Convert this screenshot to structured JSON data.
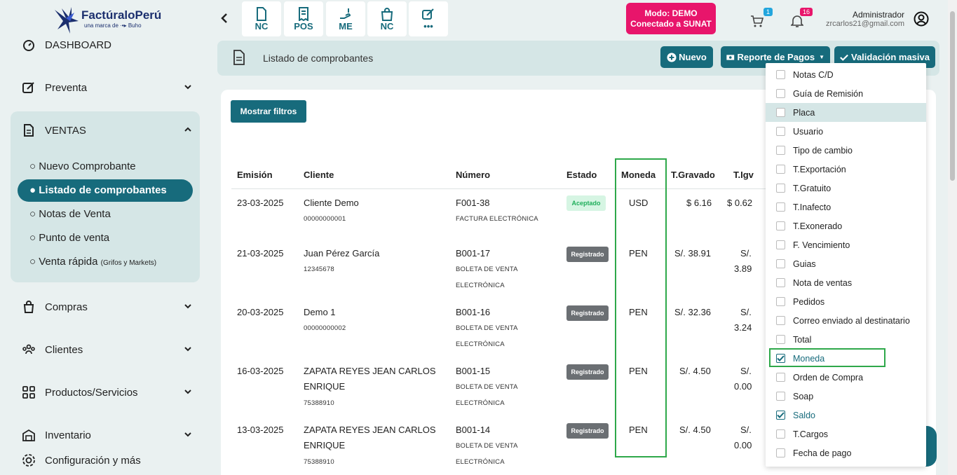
{
  "brand": {
    "name": "FactúraloPerú",
    "sub": "una marca de ·•▸ Buho"
  },
  "sidebar": {
    "dashboard": "DASHBOARD",
    "preventa": "Preventa",
    "ventas": "VENTAS",
    "ventas_items": [
      "Nuevo Comprobante",
      "Listado de comprobantes",
      "Notas de Venta",
      "Punto de venta",
      "Venta rápida"
    ],
    "venta_rapida_note": "(Grifos y Markets)",
    "compras": "Compras",
    "clientes": "Clientes",
    "productos": "Productos/Servicios",
    "inventario": "Inventario",
    "config": "Configuración y más"
  },
  "topbar": {
    "quick_labels": [
      "NC",
      "POS",
      "ME",
      "NC",
      "•••"
    ],
    "modo_line1": "Modo: DEMO",
    "modo_line2": "Conectado a SUNAT",
    "cart_count": "1",
    "bell_count": "16",
    "admin_name": "Administrador",
    "admin_email": "zrcarlos21@gmail.com"
  },
  "header": {
    "title": "Listado de comprobantes",
    "nuevo": "Nuevo",
    "reporte": "Reporte de Pagos",
    "validacion": "Validación masiva"
  },
  "filters": {
    "label": "Mostrar filtros"
  },
  "table": {
    "headers": [
      "Emisión",
      "Cliente",
      "Número",
      "Estado",
      "Moneda",
      "T.Gravado",
      "T.Igv"
    ],
    "rows": [
      {
        "emision": "23-03-2025",
        "cliente": [
          "Cliente Demo"
        ],
        "doc": "00000000001",
        "numero": "F001-38",
        "tipo": [
          "FACTURA ELECTRÓNICA"
        ],
        "estado": "Aceptado",
        "moneda": "USD",
        "gravado": "$ 6.16",
        "igv": [
          "$ 0.62"
        ]
      },
      {
        "emision": "21-03-2025",
        "cliente": [
          "Juan Pérez García"
        ],
        "doc": "12345678",
        "numero": "B001-17",
        "tipo": [
          "BOLETA DE VENTA",
          "ELECTRÓNICA"
        ],
        "estado": "Registrado",
        "moneda": "PEN",
        "gravado": "S/. 38.91",
        "igv": [
          "S/.",
          "3.89"
        ]
      },
      {
        "emision": "20-03-2025",
        "cliente": [
          "Demo 1"
        ],
        "doc": "00000000002",
        "numero": "B001-16",
        "tipo": [
          "BOLETA DE VENTA",
          "ELECTRÓNICA"
        ],
        "estado": "Registrado",
        "moneda": "PEN",
        "gravado": "S/. 32.36",
        "igv": [
          "S/.",
          "3.24"
        ]
      },
      {
        "emision": "16-03-2025",
        "cliente": [
          "ZAPATA REYES JEAN CARLOS",
          "ENRIQUE"
        ],
        "doc": "75388910",
        "numero": "B001-15",
        "tipo": [
          "BOLETA DE VENTA",
          "ELECTRÓNICA"
        ],
        "estado": "Registrado",
        "moneda": "PEN",
        "gravado": "S/. 4.50",
        "igv": [
          "S/.",
          "0.00"
        ]
      },
      {
        "emision": "13-03-2025",
        "cliente": [
          "ZAPATA REYES JEAN CARLOS",
          "ENRIQUE"
        ],
        "doc": "75388910",
        "numero": "B001-14",
        "tipo": [
          "BOLETA DE VENTA",
          "ELECTRÓNICA"
        ],
        "estado": "Registrado",
        "moneda": "PEN",
        "gravado": "S/. 4.50",
        "igv": [
          "S/.",
          "0.00"
        ]
      }
    ]
  },
  "columns_menu": [
    {
      "label": "Notas C/D",
      "checked": false
    },
    {
      "label": "Guía de Remisión",
      "checked": false
    },
    {
      "label": "Placa",
      "checked": false,
      "hover": true
    },
    {
      "label": "Usuario",
      "checked": false
    },
    {
      "label": "Tipo de cambio",
      "checked": false
    },
    {
      "label": "T.Exportación",
      "checked": false
    },
    {
      "label": "T.Gratuito",
      "checked": false
    },
    {
      "label": "T.Inafecto",
      "checked": false
    },
    {
      "label": "T.Exonerado",
      "checked": false
    },
    {
      "label": "F. Vencimiento",
      "checked": false
    },
    {
      "label": "Guias",
      "checked": false
    },
    {
      "label": "Nota de ventas",
      "checked": false
    },
    {
      "label": "Pedidos",
      "checked": false
    },
    {
      "label": "Correo enviado al destinatario",
      "checked": false
    },
    {
      "label": "Total",
      "checked": false
    },
    {
      "label": "Moneda",
      "checked": true
    },
    {
      "label": "Orden de Compra",
      "checked": false
    },
    {
      "label": "Soap",
      "checked": false
    },
    {
      "label": "Saldo",
      "checked": true
    },
    {
      "label": "T.Cargos",
      "checked": false
    },
    {
      "label": "Fecha de pago",
      "checked": false
    }
  ],
  "colors": {
    "teal": "#176b7c",
    "pink": "#e8156b",
    "highlight_green": "#2ea84a"
  }
}
